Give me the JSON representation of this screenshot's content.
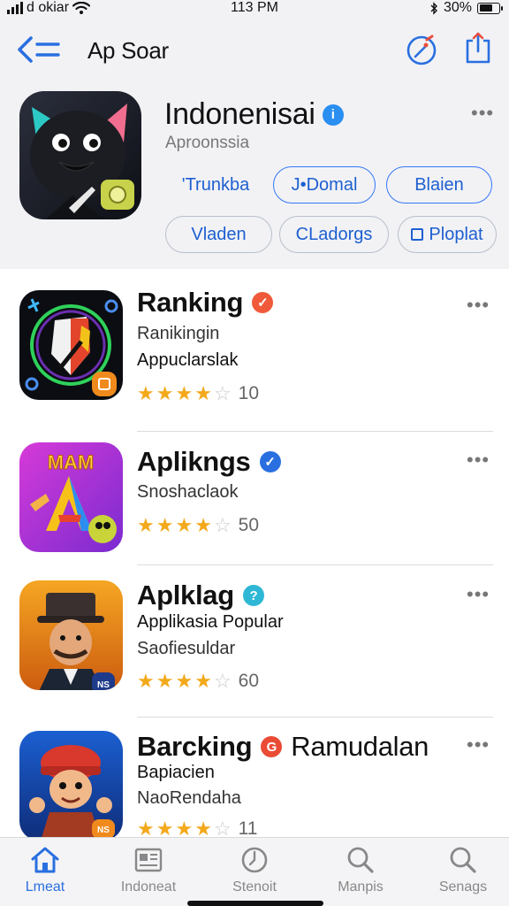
{
  "status_bar": {
    "carrier": "d okiar",
    "time": "113 PM",
    "battery": "30%"
  },
  "nav": {
    "title": "Ap Soar"
  },
  "featured": {
    "title": "Indonenisai",
    "subtitle": "Aproonssia",
    "verify_mark": "i",
    "more": "•••",
    "chips_row1": [
      "'Trunkba",
      "J•Domal",
      "Blaien"
    ],
    "chips_row2": [
      "Vladen",
      "CLadorgs",
      "Ploplat"
    ]
  },
  "apps": [
    {
      "name": "Ranking",
      "badge_mark": "✓",
      "badge_color": "#f05a3a",
      "extra": "",
      "line1": "Ranikingin",
      "line2": "Appuclarslak",
      "stars": 4,
      "score": "10",
      "more": "•••"
    },
    {
      "name": "Aplikngs",
      "badge_mark": "✓",
      "badge_color": "#2a6fe0",
      "extra": "",
      "line1": "Snoshaclaok",
      "line2": "",
      "stars": 4,
      "score": "50",
      "more": "•••"
    },
    {
      "name": "Aplklag",
      "badge_mark": "?",
      "badge_color": "#2fb7d6",
      "extra": "",
      "line1": "Applikasia Popular",
      "line2": "Saofiesuldar",
      "stars": 4,
      "score": "60",
      "more": "•••"
    },
    {
      "name": "Barcking",
      "badge_mark": "G",
      "badge_color": "#ea4b35",
      "extra": "Ramudalan",
      "line1": "Bapiacien",
      "line2": "NaoRendaha",
      "stars": 4,
      "score": "11",
      "more": "•••"
    }
  ],
  "icon_texts": {
    "app2": "MAM",
    "app3": "NS",
    "app4": "NS"
  },
  "tabs": [
    {
      "label": "Lmeat",
      "icon": "home-icon"
    },
    {
      "label": "Indoneat",
      "icon": "news-icon"
    },
    {
      "label": "Stenoit",
      "icon": "clock-icon"
    },
    {
      "label": "Manpis",
      "icon": "search-icon"
    },
    {
      "label": "Senags",
      "icon": "search-icon"
    }
  ],
  "colors": {
    "accent": "#2a6fe0",
    "star": "#f3a91b",
    "background_top": "#f2f2f5"
  }
}
